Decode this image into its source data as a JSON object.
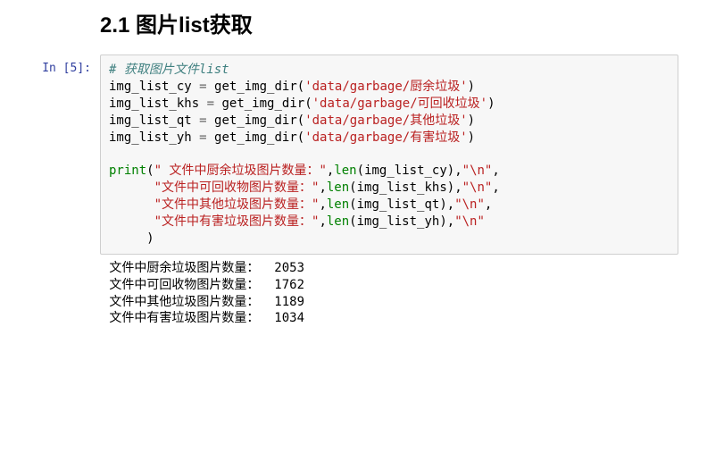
{
  "heading": "2.1  图片list获取",
  "prompt_label": "In  [5]:",
  "code": {
    "comment": "# 获取图片文件list",
    "assign": [
      {
        "var": "img_list_cy",
        "call": "get_img_dir",
        "arg": "'data/garbage/厨余垃圾'"
      },
      {
        "var": "img_list_khs",
        "call": "get_img_dir",
        "arg": "'data/garbage/可回收垃圾'"
      },
      {
        "var": "img_list_qt",
        "call": "get_img_dir",
        "arg": "'data/garbage/其他垃圾'"
      },
      {
        "var": "img_list_yh",
        "call": "get_img_dir",
        "arg": "'data/garbage/有害垃圾'"
      }
    ],
    "print_name": "print",
    "len_name": "len",
    "print_lines": [
      {
        "prefix": "(",
        "label": "\" 文件中厨余垃圾图片数量：\"",
        "len_arg": "img_list_cy",
        "nl": "\"\\n\"",
        "suffix": ","
      },
      {
        "prefix": "      ",
        "label": "\"文件中可回收物图片数量：\"",
        "len_arg": "img_list_khs",
        "nl": "\"\\n\"",
        "suffix": ","
      },
      {
        "prefix": "      ",
        "label": "\"文件中其他垃圾图片数量：\"",
        "len_arg": "img_list_qt",
        "nl": "\"\\n\"",
        "suffix": ","
      },
      {
        "prefix": "      ",
        "label": "\"文件中有害垃圾图片数量：\"",
        "len_arg": "img_list_yh",
        "nl": "\"\\n\"",
        "suffix": ""
      }
    ],
    "close_paren_indent": "     )"
  },
  "output_lines": [
    " 文件中厨余垃圾图片数量：  2053 ",
    " 文件中可回收物图片数量：  1762 ",
    " 文件中其他垃圾图片数量：  1189 ",
    " 文件中有害垃圾图片数量：  1034 "
  ]
}
